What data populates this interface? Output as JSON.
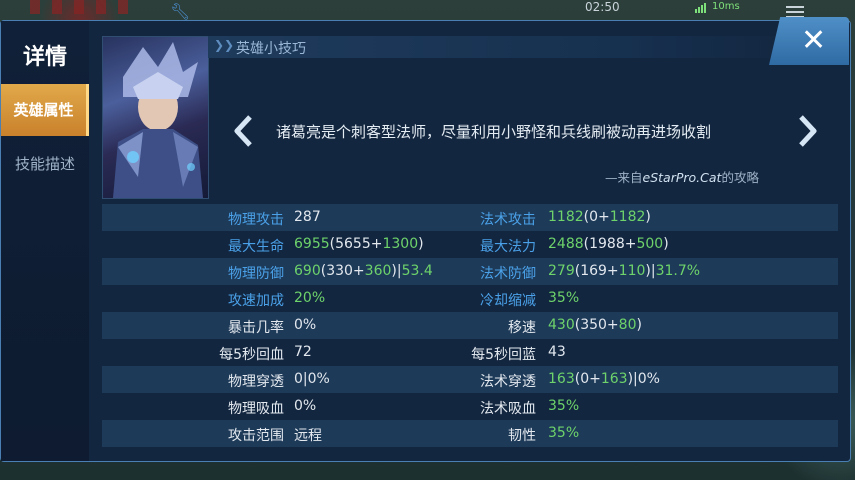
{
  "status_bar": {
    "time": "02:50",
    "ping": "10ms"
  },
  "sidebar": {
    "title": "详情",
    "tabs": [
      {
        "label": "英雄属性",
        "active": true
      },
      {
        "label": "技能描述",
        "active": false
      }
    ]
  },
  "tips": {
    "header": "英雄小技巧",
    "text": "诸葛亮是个刺客型法师，尽量利用小野怪和兵线刷被动再进场收割",
    "source_prefix": "—来自",
    "source_name": "eStarPro.Cat",
    "source_suffix": "的攻略"
  },
  "colors": {
    "label_blue": "#4aa1e8",
    "bonus_green": "#6dd36a",
    "accent_orange": "#e1a94a"
  },
  "stats": [
    {
      "left": {
        "label": "物理攻击",
        "label_color": "blue",
        "parts": [
          [
            "287",
            "w"
          ]
        ]
      },
      "right": {
        "label": "法术攻击",
        "label_color": "blue",
        "parts": [
          [
            "1182",
            "g"
          ],
          [
            "(0+",
            "w"
          ],
          [
            "1182",
            "g"
          ],
          [
            ")",
            "w"
          ]
        ]
      }
    },
    {
      "left": {
        "label": "最大生命",
        "label_color": "blue",
        "parts": [
          [
            "6955",
            "g"
          ],
          [
            "(5655+",
            "w"
          ],
          [
            "1300",
            "g"
          ],
          [
            ")",
            "w"
          ]
        ]
      },
      "right": {
        "label": "最大法力",
        "label_color": "blue",
        "parts": [
          [
            "2488",
            "g"
          ],
          [
            "(1988+",
            "w"
          ],
          [
            "500",
            "g"
          ],
          [
            ")",
            "w"
          ]
        ]
      }
    },
    {
      "left": {
        "label": "物理防御",
        "label_color": "blue",
        "parts": [
          [
            "690",
            "g"
          ],
          [
            "(330+",
            "w"
          ],
          [
            "360",
            "g"
          ],
          [
            ")|",
            "w"
          ],
          [
            "53.4",
            "g"
          ]
        ]
      },
      "right": {
        "label": "法术防御",
        "label_color": "blue",
        "parts": [
          [
            "279",
            "g"
          ],
          [
            "(169+",
            "w"
          ],
          [
            "110",
            "g"
          ],
          [
            ")|",
            "w"
          ],
          [
            "31.7%",
            "g"
          ]
        ]
      }
    },
    {
      "left": {
        "label": "攻速加成",
        "label_color": "blue",
        "parts": [
          [
            "20%",
            "g"
          ]
        ]
      },
      "right": {
        "label": "冷却缩减",
        "label_color": "blue",
        "parts": [
          [
            "35%",
            "g"
          ]
        ]
      }
    },
    {
      "left": {
        "label": "暴击几率",
        "label_color": "white",
        "parts": [
          [
            "0%",
            "w"
          ]
        ]
      },
      "right": {
        "label": "移速",
        "label_color": "white",
        "parts": [
          [
            "430",
            "g"
          ],
          [
            "(350+",
            "w"
          ],
          [
            "80",
            "g"
          ],
          [
            ")",
            "w"
          ]
        ]
      }
    },
    {
      "left": {
        "label": "每5秒回血",
        "label_color": "white",
        "parts": [
          [
            "72",
            "w"
          ]
        ]
      },
      "right": {
        "label": "每5秒回蓝",
        "label_color": "white",
        "parts": [
          [
            "43",
            "w"
          ]
        ]
      }
    },
    {
      "left": {
        "label": "物理穿透",
        "label_color": "white",
        "parts": [
          [
            "0|0%",
            "w"
          ]
        ]
      },
      "right": {
        "label": "法术穿透",
        "label_color": "white",
        "parts": [
          [
            "163",
            "g"
          ],
          [
            "(0+",
            "w"
          ],
          [
            "163",
            "g"
          ],
          [
            ")|0%",
            "w"
          ]
        ]
      }
    },
    {
      "left": {
        "label": "物理吸血",
        "label_color": "white",
        "parts": [
          [
            "0%",
            "w"
          ]
        ]
      },
      "right": {
        "label": "法术吸血",
        "label_color": "white",
        "parts": [
          [
            "35%",
            "g"
          ]
        ]
      }
    },
    {
      "left": {
        "label": "攻击范围",
        "label_color": "white",
        "parts": [
          [
            "远程",
            "w"
          ]
        ]
      },
      "right": {
        "label": "韧性",
        "label_color": "white",
        "parts": [
          [
            "35%",
            "g"
          ]
        ]
      }
    }
  ]
}
